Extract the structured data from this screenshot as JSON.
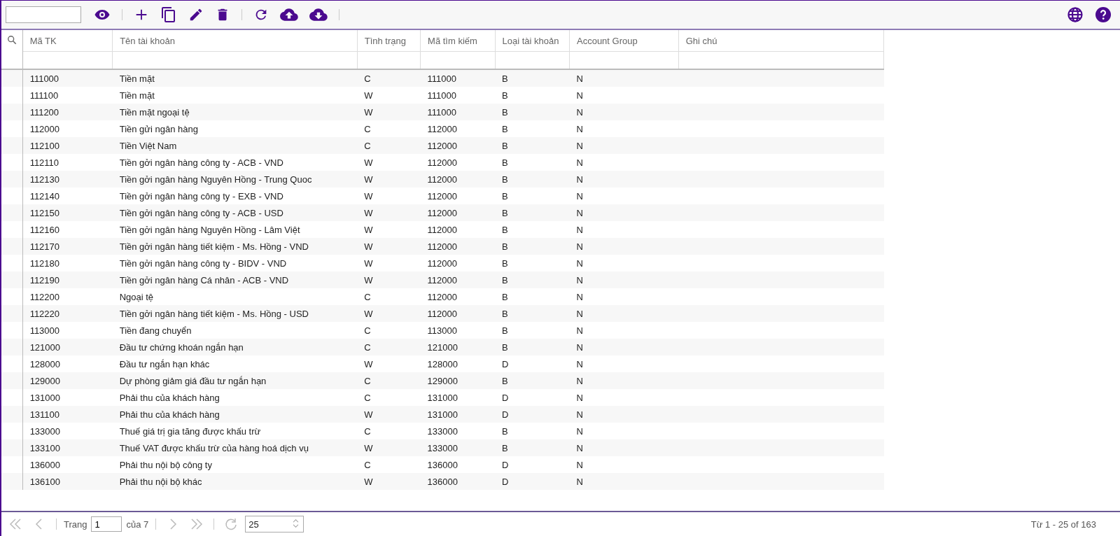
{
  "table": {
    "columns": [
      "Mã TK",
      "Tên tài khoản",
      "Tình trạng",
      "Mã tìm kiếm",
      "Loại tài khoản",
      "Account Group",
      "Ghi chú"
    ],
    "rows": [
      [
        "111000",
        "Tiền mặt",
        "C",
        "111000",
        "B",
        "N"
      ],
      [
        "111100",
        "Tiền mặt",
        "W",
        "111000",
        "B",
        "N"
      ],
      [
        "111200",
        "Tiền mặt ngoại tệ",
        "W",
        "111000",
        "B",
        "N"
      ],
      [
        "112000",
        "Tiền gửi ngân hàng",
        "C",
        "112000",
        "B",
        "N"
      ],
      [
        "112100",
        "Tiền Việt Nam",
        "C",
        "112000",
        "B",
        "N"
      ],
      [
        "112110",
        "Tiền gởi ngân hàng công ty - ACB - VND",
        "W",
        "112000",
        "B",
        "N"
      ],
      [
        "112130",
        "Tiền gởi ngân hàng Nguyên Hồng - Trung Quoc",
        "W",
        "112000",
        "B",
        "N"
      ],
      [
        "112140",
        "Tiền gởi ngân hàng công ty - EXB - VND",
        "W",
        "112000",
        "B",
        "N"
      ],
      [
        "112150",
        "Tiền gởi ngân hàng công ty - ACB - USD",
        "W",
        "112000",
        "B",
        "N"
      ],
      [
        "112160",
        "Tiền gởi ngân hàng Nguyên Hồng - Lâm Việt",
        "W",
        "112000",
        "B",
        "N"
      ],
      [
        "112170",
        "Tiền gởi ngân hàng tiết kiệm - Ms. Hồng - VND",
        "W",
        "112000",
        "B",
        "N"
      ],
      [
        "112180",
        "Tiền gởi ngân hàng công ty - BIDV - VND",
        "W",
        "112000",
        "B",
        "N"
      ],
      [
        "112190",
        "Tiền gởi ngân hàng Cá nhân - ACB - VND",
        "W",
        "112000",
        "B",
        "N"
      ],
      [
        "112200",
        "Ngoại tệ",
        "C",
        "112000",
        "B",
        "N"
      ],
      [
        "112220",
        "Tiền gởi ngân hàng tiết kiệm - Ms. Hồng - USD",
        "W",
        "112000",
        "B",
        "N"
      ],
      [
        "113000",
        "Tiền đang chuyển",
        "C",
        "113000",
        "B",
        "N"
      ],
      [
        "121000",
        "Đầu tư chứng khoán ngắn hạn",
        "C",
        "121000",
        "B",
        "N"
      ],
      [
        "128000",
        "Đầu tư ngắn hạn khác",
        "W",
        "128000",
        "D",
        "N"
      ],
      [
        "129000",
        "Dự phòng giảm giá đầu tư ngắn hạn",
        "C",
        "129000",
        "B",
        "N"
      ],
      [
        "131000",
        "Phải thu của khách hàng",
        "C",
        "131000",
        "D",
        "N"
      ],
      [
        "131100",
        "Phải thu của khách hàng",
        "W",
        "131000",
        "D",
        "N"
      ],
      [
        "133000",
        "Thuế giá trị gia tăng được khấu trừ",
        "C",
        "133000",
        "B",
        "N"
      ],
      [
        "133100",
        "Thuế VAT được khấu trừ của hàng hoá dịch vụ",
        "W",
        "133000",
        "B",
        "N"
      ],
      [
        "136000",
        "Phải thu nội bộ công ty",
        "C",
        "136000",
        "D",
        "N"
      ],
      [
        "136100",
        "Phải thu nội bộ khác",
        "W",
        "136000",
        "D",
        "N"
      ]
    ]
  },
  "pager": {
    "page_label": "Trang",
    "page": "1",
    "of_label": "của 7",
    "page_size": "25",
    "summary": "Từ 1 - 25 of 163"
  }
}
